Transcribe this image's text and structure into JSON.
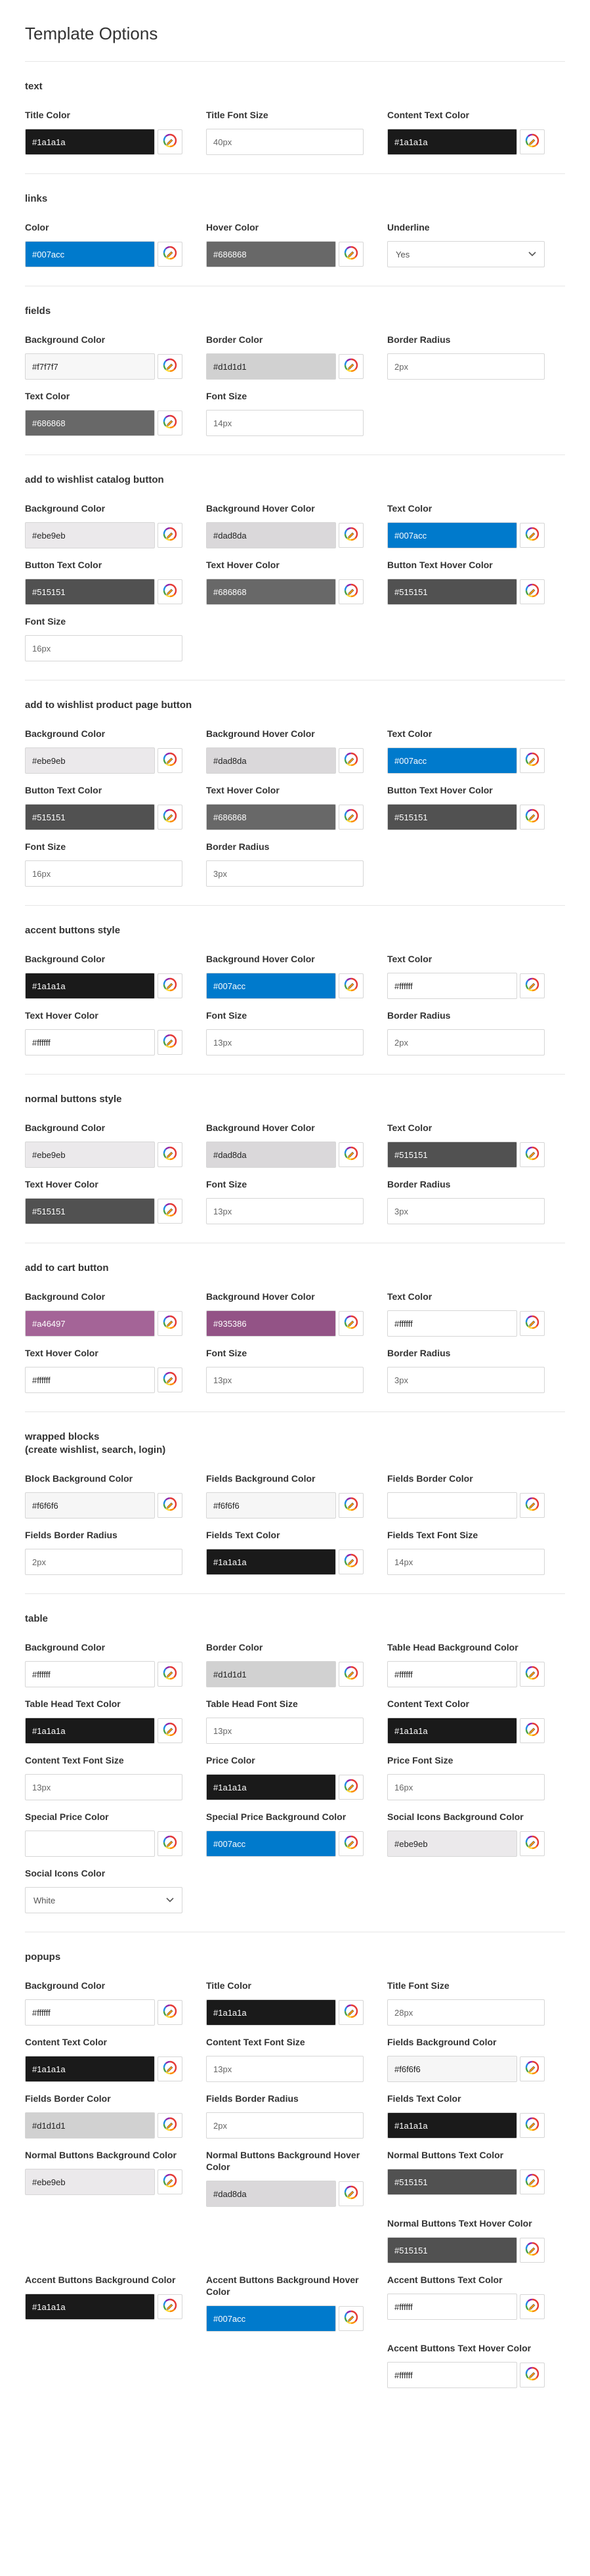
{
  "title": "Template Options",
  "sections": [
    {
      "title": "text",
      "rows": [
        [
          {
            "label": "Title Color",
            "type": "color",
            "value": "#1a1a1a",
            "bg": "#1a1a1a",
            "fg": "#ffffff"
          },
          {
            "label": "Title Font Size",
            "type": "text",
            "value": "40px"
          },
          {
            "label": "Content Text Color",
            "type": "color",
            "value": "#1a1a1a",
            "bg": "#1a1a1a",
            "fg": "#ffffff"
          }
        ]
      ]
    },
    {
      "title": "links",
      "rows": [
        [
          {
            "label": "Color",
            "type": "color",
            "value": "#007acc",
            "bg": "#007acc",
            "fg": "#ffffff"
          },
          {
            "label": "Hover Color",
            "type": "color",
            "value": "#686868",
            "bg": "#686868",
            "fg": "#ffffff"
          },
          {
            "label": "Underline",
            "type": "select",
            "value": "Yes"
          }
        ]
      ]
    },
    {
      "title": "fields",
      "rows": [
        [
          {
            "label": "Background Color",
            "type": "color",
            "value": "#f7f7f7",
            "bg": "#f7f7f7",
            "fg": "#222222"
          },
          {
            "label": "Border Color",
            "type": "color",
            "value": "#d1d1d1",
            "bg": "#d1d1d1",
            "fg": "#222222"
          },
          {
            "label": "Border Radius",
            "type": "text",
            "value": "2px"
          }
        ],
        [
          {
            "label": "Text Color",
            "type": "color",
            "value": "#686868",
            "bg": "#686868",
            "fg": "#ffffff"
          },
          {
            "label": "Font Size",
            "type": "text",
            "value": "14px"
          }
        ]
      ]
    },
    {
      "title": "add to wishlist catalog button",
      "rows": [
        [
          {
            "label": "Background Color",
            "type": "color",
            "value": "#ebe9eb",
            "bg": "#ebe9eb",
            "fg": "#222222"
          },
          {
            "label": "Background Hover Color",
            "type": "color",
            "value": "#dad8da",
            "bg": "#dad8da",
            "fg": "#222222"
          },
          {
            "label": "Text Color",
            "type": "color",
            "value": "#007acc",
            "bg": "#007acc",
            "fg": "#ffffff"
          }
        ],
        [
          {
            "label": "Button Text Color",
            "type": "color",
            "value": "#515151",
            "bg": "#515151",
            "fg": "#ffffff"
          },
          {
            "label": "Text Hover Color",
            "type": "color",
            "value": "#686868",
            "bg": "#686868",
            "fg": "#ffffff"
          },
          {
            "label": "Button Text Hover Color",
            "type": "color",
            "value": "#515151",
            "bg": "#515151",
            "fg": "#ffffff"
          }
        ],
        [
          {
            "label": "Font Size",
            "type": "text",
            "value": "16px"
          }
        ]
      ]
    },
    {
      "title": "add to wishlist product page button",
      "rows": [
        [
          {
            "label": "Background Color",
            "type": "color",
            "value": "#ebe9eb",
            "bg": "#ebe9eb",
            "fg": "#222222"
          },
          {
            "label": "Background Hover Color",
            "type": "color",
            "value": "#dad8da",
            "bg": "#dad8da",
            "fg": "#222222"
          },
          {
            "label": "Text Color",
            "type": "color",
            "value": "#007acc",
            "bg": "#007acc",
            "fg": "#ffffff"
          }
        ],
        [
          {
            "label": "Button Text Color",
            "type": "color",
            "value": "#515151",
            "bg": "#515151",
            "fg": "#ffffff"
          },
          {
            "label": "Text Hover Color",
            "type": "color",
            "value": "#686868",
            "bg": "#686868",
            "fg": "#ffffff"
          },
          {
            "label": "Button Text Hover Color",
            "type": "color",
            "value": "#515151",
            "bg": "#515151",
            "fg": "#ffffff"
          }
        ],
        [
          {
            "label": "Font Size",
            "type": "text",
            "value": "16px"
          },
          {
            "label": "Border Radius",
            "type": "text",
            "value": "3px"
          }
        ]
      ]
    },
    {
      "title": "accent buttons style",
      "rows": [
        [
          {
            "label": "Background Color",
            "type": "color",
            "value": "#1a1a1a",
            "bg": "#1a1a1a",
            "fg": "#ffffff"
          },
          {
            "label": "Background Hover Color",
            "type": "color",
            "value": "#007acc",
            "bg": "#007acc",
            "fg": "#ffffff"
          },
          {
            "label": "Text Color",
            "type": "color",
            "value": "#ffffff",
            "bg": "#ffffff",
            "fg": "#222222"
          }
        ],
        [
          {
            "label": "Text Hover Color",
            "type": "color",
            "value": "#ffffff",
            "bg": "#ffffff",
            "fg": "#222222"
          },
          {
            "label": "Font Size",
            "type": "text",
            "value": "13px"
          },
          {
            "label": "Border Radius",
            "type": "text",
            "value": "2px"
          }
        ]
      ]
    },
    {
      "title": "normal buttons style",
      "rows": [
        [
          {
            "label": "Background Color",
            "type": "color",
            "value": "#ebe9eb",
            "bg": "#ebe9eb",
            "fg": "#222222"
          },
          {
            "label": "Background Hover Color",
            "type": "color",
            "value": "#dad8da",
            "bg": "#dad8da",
            "fg": "#222222"
          },
          {
            "label": "Text Color",
            "type": "color",
            "value": "#515151",
            "bg": "#515151",
            "fg": "#ffffff"
          }
        ],
        [
          {
            "label": "Text Hover Color",
            "type": "color",
            "value": "#515151",
            "bg": "#515151",
            "fg": "#ffffff"
          },
          {
            "label": "Font Size",
            "type": "text",
            "value": "13px"
          },
          {
            "label": "Border Radius",
            "type": "text",
            "value": "3px"
          }
        ]
      ]
    },
    {
      "title": "add to cart button",
      "rows": [
        [
          {
            "label": "Background Color",
            "type": "color",
            "value": "#a46497",
            "bg": "#a46497",
            "fg": "#ffffff"
          },
          {
            "label": "Background Hover Color",
            "type": "color",
            "value": "#935386",
            "bg": "#935386",
            "fg": "#ffffff"
          },
          {
            "label": "Text Color",
            "type": "color",
            "value": "#ffffff",
            "bg": "#ffffff",
            "fg": "#222222"
          }
        ],
        [
          {
            "label": "Text Hover Color",
            "type": "color",
            "value": "#ffffff",
            "bg": "#ffffff",
            "fg": "#222222"
          },
          {
            "label": "Font Size",
            "type": "text",
            "value": "13px"
          },
          {
            "label": "Border Radius",
            "type": "text",
            "value": "3px"
          }
        ]
      ]
    },
    {
      "title": "wrapped blocks\n(create wishlist, search, login)",
      "rows": [
        [
          {
            "label": "Block Background Color",
            "type": "color",
            "value": "#f6f6f6",
            "bg": "#f6f6f6",
            "fg": "#222222"
          },
          {
            "label": "Fields Background Color",
            "type": "color",
            "value": "#f6f6f6",
            "bg": "#f6f6f6",
            "fg": "#222222"
          },
          {
            "label": "Fields Border Color",
            "type": "color",
            "value": "",
            "bg": "#ffffff",
            "fg": "#222222"
          }
        ],
        [
          {
            "label": "Fields Border Radius",
            "type": "text",
            "value": "2px"
          },
          {
            "label": "Fields Text Color",
            "type": "color",
            "value": "#1a1a1a",
            "bg": "#1a1a1a",
            "fg": "#ffffff"
          },
          {
            "label": "Fields Text Font Size",
            "type": "text",
            "value": "14px"
          }
        ]
      ]
    },
    {
      "title": "table",
      "rows": [
        [
          {
            "label": "Background Color",
            "type": "color",
            "value": "#ffffff",
            "bg": "#ffffff",
            "fg": "#222222"
          },
          {
            "label": "Border Color",
            "type": "color",
            "value": "#d1d1d1",
            "bg": "#d1d1d1",
            "fg": "#222222"
          },
          {
            "label": "Table Head Background Color",
            "type": "color",
            "value": "#ffffff",
            "bg": "#ffffff",
            "fg": "#222222"
          }
        ],
        [
          {
            "label": "Table Head Text Color",
            "type": "color",
            "value": "#1a1a1a",
            "bg": "#1a1a1a",
            "fg": "#ffffff"
          },
          {
            "label": "Table Head Font Size",
            "type": "text",
            "value": "13px"
          },
          {
            "label": "Content Text Color",
            "type": "color",
            "value": "#1a1a1a",
            "bg": "#1a1a1a",
            "fg": "#ffffff"
          }
        ],
        [
          {
            "label": "Content Text Font Size",
            "type": "text",
            "value": "13px"
          },
          {
            "label": "Price Color",
            "type": "color",
            "value": "#1a1a1a",
            "bg": "#1a1a1a",
            "fg": "#ffffff"
          },
          {
            "label": "Price Font Size",
            "type": "text",
            "value": "16px"
          }
        ],
        [
          {
            "label": "Special Price Color",
            "type": "color",
            "value": "",
            "bg": "#ffffff",
            "fg": "#222222"
          },
          {
            "label": "Special Price Background Color",
            "type": "color",
            "value": "#007acc",
            "bg": "#007acc",
            "fg": "#ffffff"
          },
          {
            "label": "Social Icons Background Color",
            "type": "color",
            "value": "#ebe9eb",
            "bg": "#ebe9eb",
            "fg": "#222222"
          }
        ],
        [
          {
            "label": "Social Icons Color",
            "type": "select",
            "value": "White"
          }
        ]
      ]
    },
    {
      "title": "popups",
      "rows": [
        [
          {
            "label": "Background Color",
            "type": "color",
            "value": "#ffffff",
            "bg": "#ffffff",
            "fg": "#222222"
          },
          {
            "label": "Title Color",
            "type": "color",
            "value": "#1a1a1a",
            "bg": "#1a1a1a",
            "fg": "#ffffff"
          },
          {
            "label": "Title Font Size",
            "type": "text",
            "value": "28px"
          }
        ],
        [
          {
            "label": "Content Text Color",
            "type": "color",
            "value": "#1a1a1a",
            "bg": "#1a1a1a",
            "fg": "#ffffff"
          },
          {
            "label": "Content Text Font Size",
            "type": "text",
            "value": "13px"
          },
          {
            "label": "Fields Background Color",
            "type": "color",
            "value": "#f6f6f6",
            "bg": "#f6f6f6",
            "fg": "#222222"
          }
        ],
        [
          {
            "label": "Fields Border Color",
            "type": "color",
            "value": "#d1d1d1",
            "bg": "#d1d1d1",
            "fg": "#222222"
          },
          {
            "label": "Fields Border Radius",
            "type": "text",
            "value": "2px"
          },
          {
            "label": "Fields Text Color",
            "type": "color",
            "value": "#1a1a1a",
            "bg": "#1a1a1a",
            "fg": "#ffffff"
          }
        ],
        [
          {
            "label": "Normal Buttons Background Color",
            "type": "color",
            "value": "#ebe9eb",
            "bg": "#ebe9eb",
            "fg": "#222222"
          },
          {
            "label": "Normal Buttons Background Hover Color",
            "type": "color",
            "value": "#dad8da",
            "bg": "#dad8da",
            "fg": "#222222"
          },
          {
            "label": "Normal Buttons Text Color",
            "type": "color",
            "value": "#515151",
            "bg": "#515151",
            "fg": "#ffffff"
          }
        ],
        [
          {
            "type": "spacer"
          },
          {
            "type": "spacer"
          },
          {
            "label": "Normal Buttons Text Hover Color",
            "type": "color",
            "value": "#515151",
            "bg": "#515151",
            "fg": "#ffffff"
          }
        ],
        [
          {
            "label": "Accent Buttons Background Color",
            "type": "color",
            "value": "#1a1a1a",
            "bg": "#1a1a1a",
            "fg": "#ffffff"
          },
          {
            "label": "Accent Buttons Background Hover Color",
            "type": "color",
            "value": "#007acc",
            "bg": "#007acc",
            "fg": "#ffffff"
          },
          {
            "label": "Accent Buttons Text Color",
            "type": "color",
            "value": "#ffffff",
            "bg": "#ffffff",
            "fg": "#222222"
          }
        ],
        [
          {
            "type": "spacer"
          },
          {
            "type": "spacer"
          },
          {
            "label": "Accent Buttons Text Hover Color",
            "type": "color",
            "value": "#ffffff",
            "bg": "#ffffff",
            "fg": "#222222"
          }
        ]
      ]
    }
  ],
  "icons": {
    "picker": "color-picker-icon",
    "select": "chevron-down-icon"
  }
}
